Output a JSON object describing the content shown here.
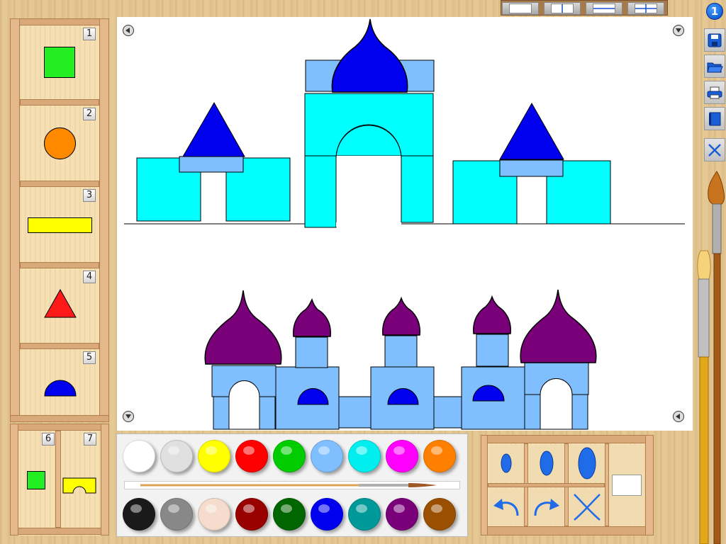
{
  "toolbar_top": {
    "user_badge": "1",
    "layouts": [
      "layout-blank",
      "layout-vertical-split",
      "layout-horizontal-split",
      "layout-quad-split"
    ]
  },
  "shapes_panel": {
    "items": [
      {
        "number": "1",
        "shape": "square",
        "color": "#22ee22"
      },
      {
        "number": "2",
        "shape": "circle",
        "color": "#ff8a00"
      },
      {
        "number": "3",
        "shape": "rectangle",
        "color": "#ffff00"
      },
      {
        "number": "4",
        "shape": "triangle",
        "color": "#ff1a1a"
      },
      {
        "number": "5",
        "shape": "half-circle",
        "color": "#0000ee"
      }
    ],
    "extra": [
      {
        "number": "6",
        "shape": "small-square",
        "color": "#22ee22"
      },
      {
        "number": "7",
        "shape": "arch-block",
        "color": "#ffff00"
      }
    ]
  },
  "side_toolbar": {
    "buttons": [
      "save-icon",
      "open-folder-icon",
      "print-icon",
      "book-icon",
      "close-icon"
    ]
  },
  "palette": {
    "row1": [
      "#ffffff",
      "#e0e0e0",
      "#ffff00",
      "#ff0000",
      "#00cc00",
      "#7fbfff",
      "#00eeee",
      "#ff00ff",
      "#ff8000"
    ],
    "row2": [
      "#1a1a1a",
      "#888888",
      "#f5dccc",
      "#990000",
      "#006600",
      "#0000ee",
      "#009999",
      "#7a007a",
      "#9a5000"
    ]
  },
  "tools": {
    "brush_sizes": [
      "small",
      "medium",
      "large"
    ],
    "actions": [
      "undo-icon",
      "redo-icon",
      "clear-icon"
    ],
    "current_color": "#ffffff"
  },
  "colors": {
    "cyan": "#00ffff",
    "light_blue": "#80bfff",
    "blue": "#0000ee",
    "purple": "#7a007a"
  }
}
